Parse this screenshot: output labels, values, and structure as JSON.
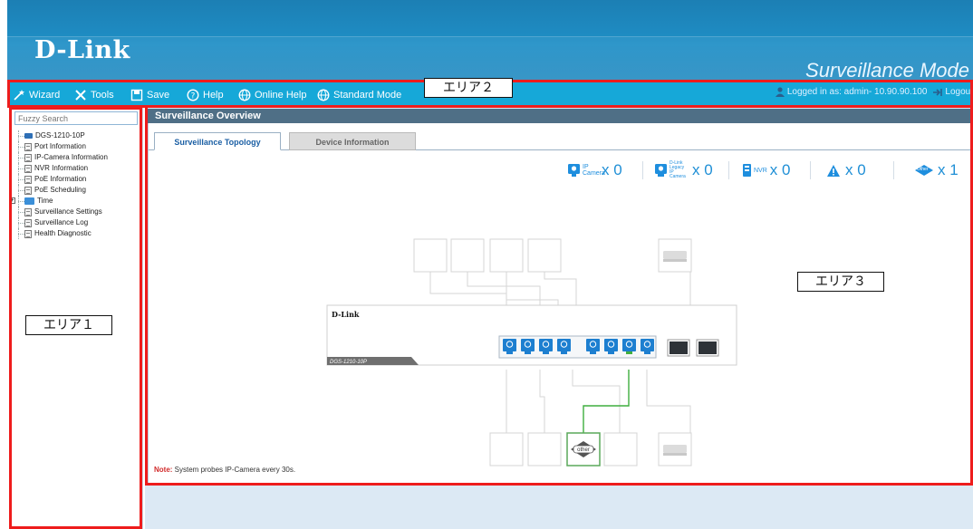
{
  "brand": {
    "logo": "D-Link",
    "mode_title": "Surveillance Mode"
  },
  "toolbar": {
    "items": [
      {
        "label": "Wizard",
        "icon": "wizard-icon"
      },
      {
        "label": "Tools",
        "icon": "tools-icon"
      },
      {
        "label": "Save",
        "icon": "save-icon"
      },
      {
        "label": "Help",
        "icon": "help-icon"
      },
      {
        "label": "Online Help",
        "icon": "globe-icon"
      },
      {
        "label": "Standard Mode",
        "icon": "globe-icon"
      }
    ],
    "login_text": "Logged in as: admin- 10.90.90.100",
    "logout_label": "Logout"
  },
  "sidebar": {
    "search_placeholder": "Fuzzy Search",
    "items": [
      {
        "label": "DGS-1210-10P",
        "type": "root"
      },
      {
        "label": "Port Information",
        "type": "doc"
      },
      {
        "label": "IP-Camera Information",
        "type": "doc"
      },
      {
        "label": "NVR Information",
        "type": "doc"
      },
      {
        "label": "PoE Information",
        "type": "doc"
      },
      {
        "label": "PoE Scheduling",
        "type": "doc"
      },
      {
        "label": "Time",
        "type": "folder"
      },
      {
        "label": "Surveillance Settings",
        "type": "doc"
      },
      {
        "label": "Surveillance Log",
        "type": "doc"
      },
      {
        "label": "Health Diagnostic",
        "type": "doc"
      }
    ]
  },
  "main": {
    "title": "Surveillance Overview",
    "tabs": [
      {
        "label": "Surveillance Topology",
        "active": true
      },
      {
        "label": "Device Information",
        "active": false
      }
    ],
    "stats": [
      {
        "label": "IP Camera",
        "count": "x 0",
        "icon": "ip-camera-icon"
      },
      {
        "label": "D-Link Legacy IP Camera",
        "count": "x 0",
        "icon": "legacy-camera-icon"
      },
      {
        "label": "NVR",
        "count": "x 0",
        "icon": "nvr-icon"
      },
      {
        "label": "",
        "count": "x 0",
        "icon": "warning-icon"
      },
      {
        "label": "Other",
        "count": "x 1",
        "icon": "other-device-icon"
      }
    ],
    "switch_brand": "D-Link",
    "switch_model": "DGS-1210-10P",
    "other_device_label": "other",
    "note_prefix": "Note:",
    "note_text": " System probes IP-Camera every 30s."
  },
  "annotations": {
    "area1": "エリア１",
    "area2": "エリア２",
    "area3": "エリア３",
    "outline_color": "#ee1c1c"
  }
}
